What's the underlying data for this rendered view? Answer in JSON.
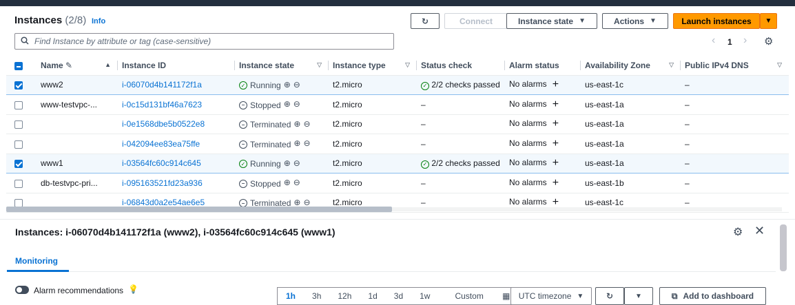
{
  "header": {
    "title": "Instances",
    "count": "(2/8)",
    "info": "Info"
  },
  "toolbar": {
    "refresh_icon": "refresh-icon",
    "connect_label": "Connect",
    "instance_state_label": "Instance state",
    "actions_label": "Actions",
    "launch_label": "Launch instances",
    "caret": "▼"
  },
  "search": {
    "placeholder": "Find Instance by attribute or tag (case-sensitive)"
  },
  "pagination": {
    "prev": "‹",
    "page": "1",
    "next": "›"
  },
  "columns": [
    "Name",
    "Instance ID",
    "Instance state",
    "Instance type",
    "Status check",
    "Alarm status",
    "Availability Zone",
    "Public IPv4 DNS"
  ],
  "rows": [
    {
      "selected": true,
      "name": "www2",
      "id": "i-06070d4b141172f1a",
      "state": "Running",
      "state_glyph": "✓",
      "type": "t2.micro",
      "status": "2/2 checks passed",
      "alarm": "No alarms",
      "az": "us-east-1c",
      "dns": "–"
    },
    {
      "selected": false,
      "name": "www-testvpc-...",
      "id": "i-0c15d131bf46a7623",
      "state": "Stopped",
      "state_glyph": "−",
      "type": "t2.micro",
      "status": "–",
      "alarm": "No alarms",
      "az": "us-east-1a",
      "dns": "–"
    },
    {
      "selected": false,
      "name": "",
      "id": "i-0e1568dbe5b0522e8",
      "state": "Terminated",
      "state_glyph": "−",
      "type": "t2.micro",
      "status": "–",
      "alarm": "No alarms",
      "az": "us-east-1a",
      "dns": "–"
    },
    {
      "selected": false,
      "name": "",
      "id": "i-042094ee83ea75ffe",
      "state": "Terminated",
      "state_glyph": "−",
      "type": "t2.micro",
      "status": "–",
      "alarm": "No alarms",
      "az": "us-east-1a",
      "dns": "–"
    },
    {
      "selected": true,
      "name": "www1",
      "id": "i-03564fc60c914c645",
      "state": "Running",
      "state_glyph": "✓",
      "type": "t2.micro",
      "status": "2/2 checks passed",
      "alarm": "No alarms",
      "az": "us-east-1a",
      "dns": "–"
    },
    {
      "selected": false,
      "name": "db-testvpc-pri...",
      "id": "i-095163521fd23a936",
      "state": "Stopped",
      "state_glyph": "−",
      "type": "t2.micro",
      "status": "–",
      "alarm": "No alarms",
      "az": "us-east-1b",
      "dns": "–"
    },
    {
      "selected": false,
      "name": "",
      "id": "i-06843d0a2e54ae6e5",
      "state": "Terminated",
      "state_glyph": "−",
      "type": "t2.micro",
      "status": "–",
      "alarm": "No alarms",
      "az": "us-east-1c",
      "dns": "–"
    }
  ],
  "detail": {
    "title": "Instances: i-06070d4b141172f1a (www2), i-03564fc60c914c645 (www1)",
    "tab": "Monitoring",
    "alarm_recommendations": "Alarm recommendations",
    "ranges": [
      "1h",
      "3h",
      "12h",
      "1d",
      "3d",
      "1w",
      "Custom"
    ],
    "active_range": "1h",
    "timezone": "UTC timezone",
    "add_dashboard": "Add to dashboard"
  },
  "colors": {
    "accent": "#0972d3",
    "launch": "#ff9900",
    "ok": "#037f0c"
  }
}
